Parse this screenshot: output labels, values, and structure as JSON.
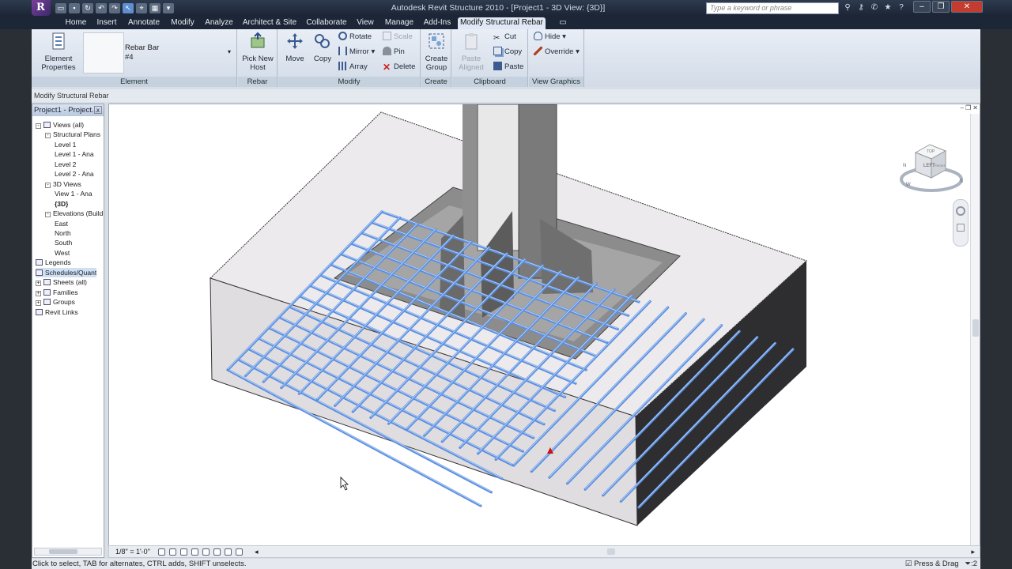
{
  "app": {
    "title": "Autodesk Revit Structure 2010 - [Project1 - 3D View: {3D}]",
    "logo": "R"
  },
  "search": {
    "placeholder": "Type a keyword or phrase"
  },
  "tabs": [
    "Home",
    "Insert",
    "Annotate",
    "Modify",
    "Analyze",
    "Architect & Site",
    "Collaborate",
    "View",
    "Manage",
    "Add-Ins",
    "Modify Structural Rebar"
  ],
  "ribbon": {
    "element": {
      "properties_label": "Element\nProperties",
      "type_name": "Rebar Bar",
      "type_size": "#4",
      "panel": "Element"
    },
    "rebar": {
      "pick_new_host": "Pick New\nHost",
      "panel": "Rebar"
    },
    "modify": {
      "move": "Move",
      "copy": "Copy",
      "rotate": "Rotate",
      "mirror": "Mirror",
      "array": "Array",
      "scale": "Scale",
      "pin": "Pin",
      "delete": "Delete",
      "panel": "Modify"
    },
    "create": {
      "create_group": "Create\nGroup",
      "panel": "Create"
    },
    "clipboard": {
      "paste_aligned": "Paste\nAligned",
      "cut": "Cut",
      "copy": "Copy",
      "paste": "Paste",
      "panel": "Clipboard"
    },
    "view_graphics": {
      "hide": "Hide",
      "override": "Override",
      "panel": "View Graphics"
    }
  },
  "options_bar": {
    "text": "Modify Structural Rebar"
  },
  "browser": {
    "title": "Project1 - Project...",
    "close": "x",
    "items": [
      {
        "label": "Views (all)",
        "level": 0,
        "exp": "-",
        "icon": "views"
      },
      {
        "label": "Structural Plans",
        "level": 1,
        "exp": "-"
      },
      {
        "label": "Level 1",
        "level": 2
      },
      {
        "label": "Level 1 - Ana",
        "level": 2
      },
      {
        "label": "Level 2",
        "level": 2
      },
      {
        "label": "Level 2 - Ana",
        "level": 2
      },
      {
        "label": "3D Views",
        "level": 1,
        "exp": "-"
      },
      {
        "label": "View 1 - Ana",
        "level": 2
      },
      {
        "label": "{3D}",
        "level": 2,
        "bold": true
      },
      {
        "label": "Elevations (Build",
        "level": 1,
        "exp": "-"
      },
      {
        "label": "East",
        "level": 2
      },
      {
        "label": "North",
        "level": 2
      },
      {
        "label": "South",
        "level": 2
      },
      {
        "label": "West",
        "level": 2
      },
      {
        "label": "Legends",
        "level": 0,
        "icon": "legend"
      },
      {
        "label": "Schedules/Quant",
        "level": 0,
        "icon": "schedule",
        "sel": true
      },
      {
        "label": "Sheets (all)",
        "level": 0,
        "exp": "+",
        "icon": "sheet"
      },
      {
        "label": "Families",
        "level": 0,
        "exp": "+",
        "icon": "family"
      },
      {
        "label": "Groups",
        "level": 0,
        "exp": "+",
        "icon": "group"
      },
      {
        "label": "Revit Links",
        "level": 0,
        "icon": "link"
      }
    ]
  },
  "viewcube": {
    "face": "LEFT",
    "top": "TOP",
    "front": "FRONT",
    "compass": [
      "N",
      "W",
      "S"
    ]
  },
  "view_bar": {
    "scale": "1/8\" = 1'-0\""
  },
  "status": {
    "text": "Click to select, TAB for alternates, CTRL adds, SHIFT unselects.",
    "press_drag": "Press & Drag",
    "filter_count": ":2"
  },
  "colors": {
    "rebar": "#5b8fe0",
    "concrete": "#e3e0e2",
    "steel": "#b5b5b5",
    "accent": "#c9d8ec"
  }
}
